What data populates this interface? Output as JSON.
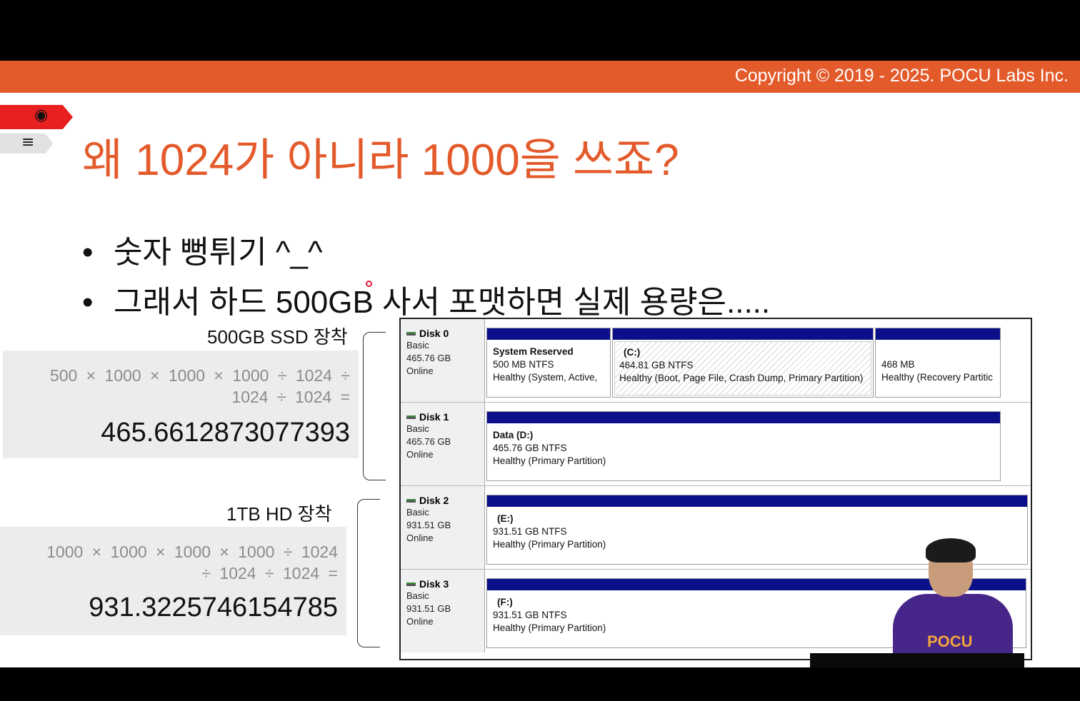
{
  "header": {
    "copyright": "Copyright © 2019 - 2025. POCU Labs Inc."
  },
  "side_icons": [
    "brain-icon",
    "book-stack-icon"
  ],
  "slide": {
    "title": "왜 1024가 아니라 1000을 쓰죠?",
    "bullets": [
      "숫자 뻥튀기 ^_^",
      "그래서 하드 500GB 사서 포맷하면 실제 용량은....."
    ]
  },
  "calculations": [
    {
      "label": "500GB SSD 장착",
      "line1": "500 × 1000 × 1000 × 1000 ÷ 1024 ÷",
      "line2": "1024 ÷ 1024 =",
      "result": "465.6612873077393"
    },
    {
      "label": "1TB HD 장착",
      "line1": "1000 × 1000 × 1000 × 1000 ÷ 1024",
      "line2": "÷ 1024 ÷ 1024 =",
      "result": "931.3225746154785"
    }
  ],
  "disks": [
    {
      "name": "Disk 0",
      "type": "Basic",
      "size": "465.76 GB",
      "status": "Online",
      "partitions": [
        {
          "name": "System Reserved",
          "size": "500 MB NTFS",
          "health": "Healthy (System, Active,"
        },
        {
          "name": "(C:)",
          "size": "464.81 GB NTFS",
          "health": "Healthy (Boot, Page File, Crash Dump, Primary Partition)"
        },
        {
          "name": "",
          "size": "468 MB",
          "health": "Healthy (Recovery Partitic"
        }
      ]
    },
    {
      "name": "Disk 1",
      "type": "Basic",
      "size": "465.76 GB",
      "status": "Online",
      "partitions": [
        {
          "name": "Data  (D:)",
          "size": "465.76 GB NTFS",
          "health": "Healthy (Primary Partition)"
        }
      ]
    },
    {
      "name": "Disk 2",
      "type": "Basic",
      "size": "931.51 GB",
      "status": "Online",
      "partitions": [
        {
          "name": "(E:)",
          "size": "931.51 GB NTFS",
          "health": "Healthy (Primary Partition)"
        }
      ]
    },
    {
      "name": "Disk 3",
      "type": "Basic",
      "size": "931.51 GB",
      "status": "Online",
      "partitions": [
        {
          "name": "(F:)",
          "size": "931.51 GB NTFS",
          "health": "Healthy (Primary Partition)"
        }
      ]
    }
  ],
  "presenter": {
    "shirt_logo": "POCU"
  },
  "colors": {
    "accent": "#e35a2b",
    "partition_band": "#0b0f8a",
    "flag_red": "#e8201f"
  }
}
